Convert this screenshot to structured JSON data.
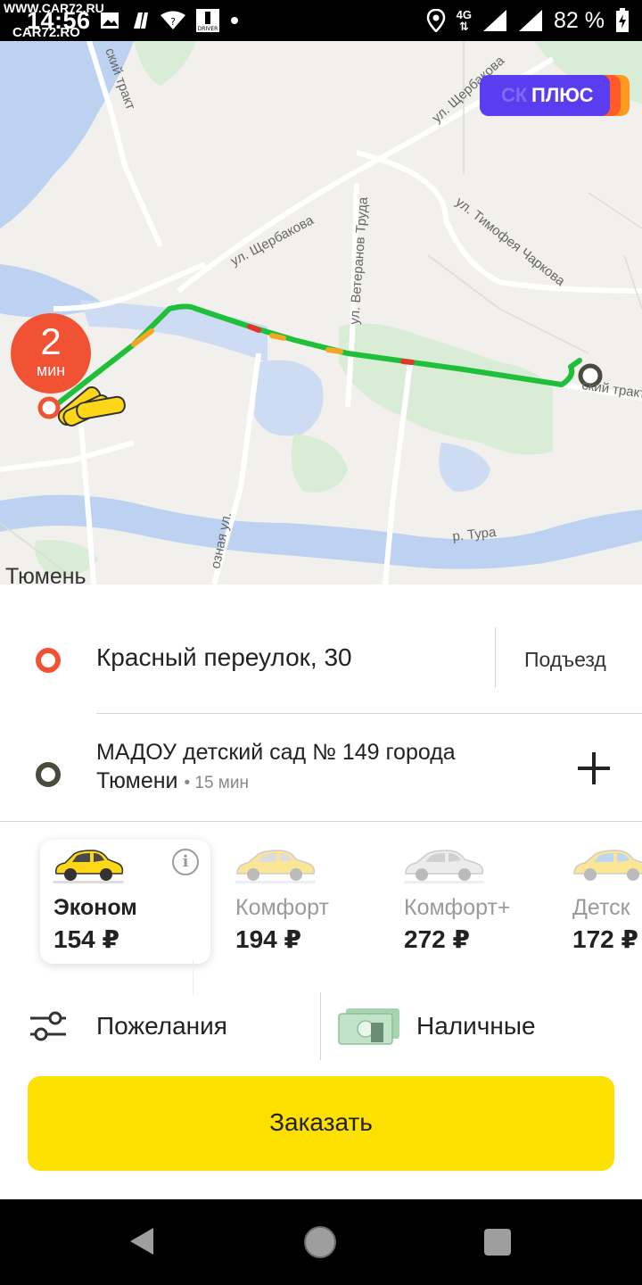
{
  "status_bar": {
    "time": "14:56",
    "watermark_top": "WWW.CAR72.RU",
    "watermark_bottom": "CAR72.RO",
    "network": "4G",
    "battery": "82 %"
  },
  "map": {
    "eta_value": "2",
    "eta_unit": "мин",
    "plus_badge_ghost": "СК",
    "plus_badge": "ПЛЮС",
    "city": "Тюмень",
    "street_labels": [
      "ул. Щербакова",
      "ул. Щербакова",
      "ул. Ветеранов Труда",
      "ул. Тимофея Чаркова",
      "р. Тура",
      "ский тракт",
      "ский тракт",
      "озная ул."
    ]
  },
  "route": {
    "from": "Красный переулок, 30",
    "entrance": "Подъезд",
    "to_line1": "МАДОУ детский сад № 149 города",
    "to_line2": "Тюмени",
    "to_duration": "• 15 мин"
  },
  "tariffs": [
    {
      "name": "Эконом",
      "price": "154 ₽",
      "selected": true,
      "car_color": "#fdd618"
    },
    {
      "name": "Комфорт",
      "price": "194 ₽",
      "selected": false,
      "car_color": "#fbe696"
    },
    {
      "name": "Комфорт+",
      "price": "272 ₽",
      "selected": false,
      "car_color": "#e9e9e9"
    },
    {
      "name": "Детск",
      "price": "172 ₽",
      "selected": false,
      "car_color": "#fbe696"
    }
  ],
  "options": {
    "wishes": "Пожелания",
    "payment": "Наличные"
  },
  "order_button": "Заказать",
  "colors": {
    "accent_yellow": "#fce000",
    "pickup_red": "#f25234",
    "plus_purple": "#5b3df0",
    "route_green": "#1fbf3a"
  }
}
